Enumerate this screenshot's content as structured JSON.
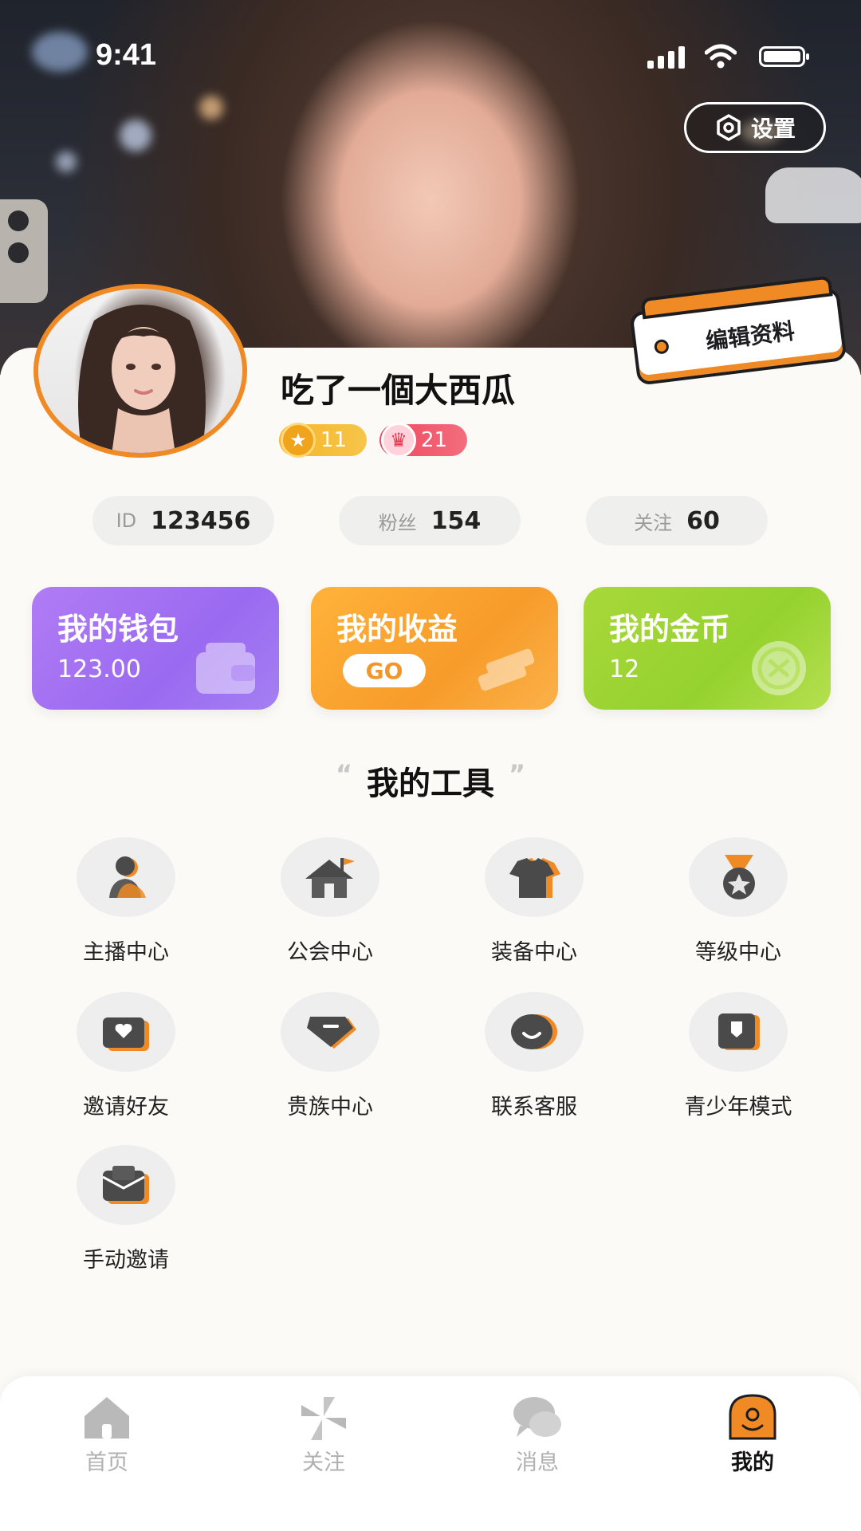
{
  "status_bar": {
    "time": "9:41"
  },
  "header": {
    "settings_label": "设置"
  },
  "profile": {
    "edit_label": "编辑资料",
    "username": "吃了一個大西瓜",
    "level_badge": "11",
    "vip_badge": "21",
    "stats": [
      {
        "key": "ID",
        "value": "123456"
      },
      {
        "key": "粉丝",
        "value": "154"
      },
      {
        "key": "关注",
        "value": "60"
      }
    ]
  },
  "cards": [
    {
      "title": "我的钱包",
      "value": "123.00",
      "color": "#a474f3"
    },
    {
      "title": "我的收益",
      "value": "GO",
      "color": "#f8a22f"
    },
    {
      "title": "我的金币",
      "value": "12",
      "color": "#a0d636"
    }
  ],
  "tools": {
    "title": "我的工具",
    "open_quote": "“",
    "close_quote": "”",
    "items": [
      {
        "label": "主播中心",
        "icon": "anchor-icon"
      },
      {
        "label": "公会中心",
        "icon": "guild-house-icon"
      },
      {
        "label": "装备中心",
        "icon": "shirt-icon"
      },
      {
        "label": "等级中心",
        "icon": "medal-icon"
      },
      {
        "label": "邀请好友",
        "icon": "invite-heart-icon"
      },
      {
        "label": "贵族中心",
        "icon": "diamond-icon"
      },
      {
        "label": "联系客服",
        "icon": "chat-icon"
      },
      {
        "label": "青少年模式",
        "icon": "shield-icon"
      },
      {
        "label": "手动邀请",
        "icon": "mail-icon"
      }
    ]
  },
  "tabbar": {
    "items": [
      {
        "label": "首页",
        "icon": "home-icon"
      },
      {
        "label": "关注",
        "icon": "follow-icon"
      },
      {
        "label": "消息",
        "icon": "message-icon"
      },
      {
        "label": "我的",
        "icon": "mine-icon"
      }
    ],
    "active": "我的"
  },
  "colors": {
    "accent": "#f08a24",
    "text": "#111111",
    "muted": "#b0b0b0"
  }
}
